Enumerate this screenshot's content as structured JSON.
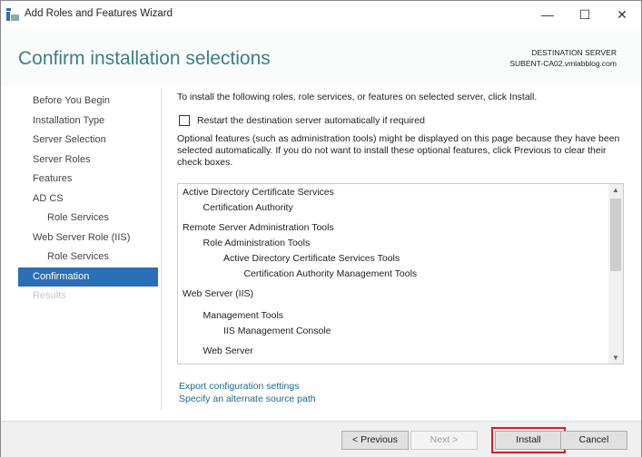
{
  "window": {
    "title": "Add Roles and Features Wizard",
    "minimize": "—",
    "maximize": "☐",
    "close": "✕"
  },
  "header": {
    "title": "Confirm installation selections",
    "dest_label": "DESTINATION SERVER",
    "dest_server": "SUBENT-CA02.vmlabblog.com"
  },
  "nav": [
    {
      "label": "Before You Begin",
      "state": "normal"
    },
    {
      "label": "Installation Type",
      "state": "normal"
    },
    {
      "label": "Server Selection",
      "state": "normal"
    },
    {
      "label": "Server Roles",
      "state": "normal"
    },
    {
      "label": "Features",
      "state": "normal"
    },
    {
      "label": "AD CS",
      "state": "normal"
    },
    {
      "label": "Role Services",
      "state": "sub"
    },
    {
      "label": "Web Server Role (IIS)",
      "state": "normal"
    },
    {
      "label": "Role Services",
      "state": "sub"
    },
    {
      "label": "Confirmation",
      "state": "active"
    },
    {
      "label": "Results",
      "state": "disabled"
    }
  ],
  "main": {
    "intro": "To install the following roles, role services, or features on selected server, click Install.",
    "restart_label": "Restart the destination server automatically if required",
    "restart_checked": false,
    "optional_text": "Optional features (such as administration tools) might be displayed on this page because they have been selected automatically. If you do not want to install these optional features, click Previous to clear their check boxes.",
    "items": [
      {
        "text": "Active Directory Certificate Services",
        "level": 0
      },
      {
        "text": "Certification Authority",
        "level": 1
      },
      {
        "text": "Remote Server Administration Tools",
        "level": 0
      },
      {
        "text": "Role Administration Tools",
        "level": 1
      },
      {
        "text": "Active Directory Certificate Services Tools",
        "level": 2
      },
      {
        "text": "Certification Authority Management Tools",
        "level": 3
      },
      {
        "text": "Web Server (IIS)",
        "level": 0
      },
      {
        "text": "Management Tools",
        "level": 1
      },
      {
        "text": "IIS Management Console",
        "level": 2
      },
      {
        "text": "Web Server",
        "level": 1
      }
    ],
    "export_link": "Export configuration settings",
    "alt_source_link": "Specify an alternate source path"
  },
  "footer": {
    "previous": "< Previous",
    "next": "Next >",
    "install": "Install",
    "cancel": "Cancel"
  }
}
